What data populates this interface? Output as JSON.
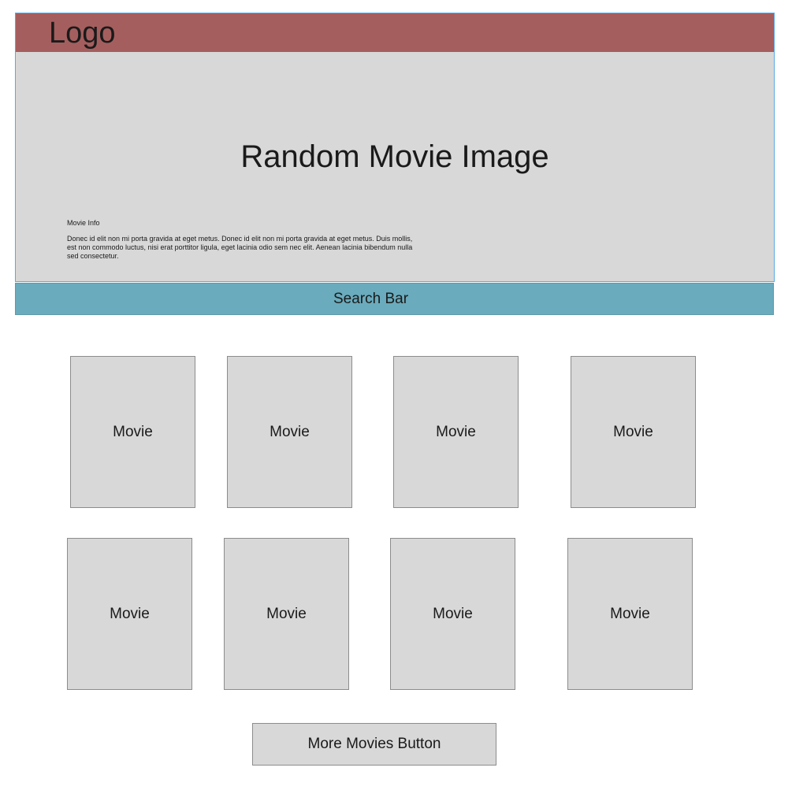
{
  "header": {
    "logo": "Logo"
  },
  "hero": {
    "title": "Random Movie Image",
    "info_label": "Movie Info",
    "info_text": "Donec id elit non mi porta gravida at eget metus. Donec id elit non mi porta gravida at eget metus. Duis mollis, est non commodo luctus, nisi erat porttitor ligula, eget lacinia odio sem nec elit. Aenean lacinia bibendum nulla sed consectetur."
  },
  "search": {
    "label": "Search Bar"
  },
  "movies": [
    {
      "label": "Movie"
    },
    {
      "label": "Movie"
    },
    {
      "label": "Movie"
    },
    {
      "label": "Movie"
    },
    {
      "label": "Movie"
    },
    {
      "label": "Movie"
    },
    {
      "label": "Movie"
    },
    {
      "label": "Movie"
    }
  ],
  "more_button": {
    "label": "More Movies Button"
  },
  "colors": {
    "header_bar": "#a55e5e",
    "search_bar": "#6aabbd",
    "placeholder_gray": "#d8d8d8",
    "hero_border": "#5aa9e6"
  }
}
